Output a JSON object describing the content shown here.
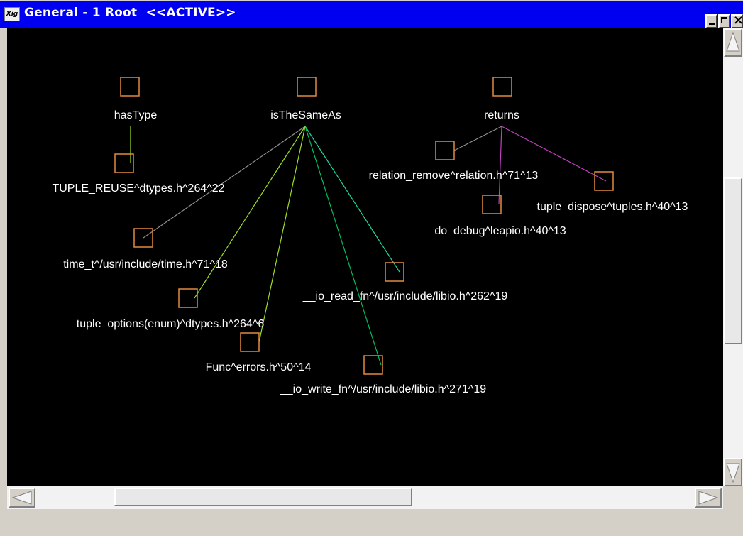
{
  "window": {
    "title": "General - 1 Root  <<ACTIVE>>",
    "icon": "app-icon",
    "close_label": "×"
  },
  "colors": {
    "title_bar": "#0000f0",
    "canvas_background": "#000000",
    "node_border": "#e08a40",
    "label": "#ffffff",
    "edge_gray": "#909090",
    "edge_yellow_green": "#a0e020",
    "edge_green": "#00c060",
    "edge_teal": "#20d8a0",
    "edge_magenta": "#c040c0"
  },
  "graph": {
    "nodes": [
      {
        "id": "hasType",
        "label": "hasType"
      },
      {
        "id": "isTheSameAs",
        "label": "isTheSameAs"
      },
      {
        "id": "returns",
        "label": "returns"
      },
      {
        "id": "tuple_reuse",
        "label": "TUPLE_REUSE^dtypes.h^264^22"
      },
      {
        "id": "relation_remove",
        "label": "relation_remove^relation.h^71^13"
      },
      {
        "id": "tuple_dispose",
        "label": "tuple_dispose^tuples.h^40^13"
      },
      {
        "id": "do_debug",
        "label": "do_debug^leapio.h^40^13"
      },
      {
        "id": "time_t",
        "label": "time_t^/usr/include/time.h^71^18"
      },
      {
        "id": "io_read_fn",
        "label": "__io_read_fn^/usr/include/libio.h^262^19"
      },
      {
        "id": "tuple_options",
        "label": "tuple_options(enum)^dtypes.h^264^6"
      },
      {
        "id": "func_errors",
        "label": "Func^errors.h^50^14"
      },
      {
        "id": "io_write_fn",
        "label": "__io_write_fn^/usr/include/libio.h^271^19"
      }
    ],
    "edges": [
      {
        "from": "hasType",
        "to": "tuple_reuse",
        "color": "edge_yellow_green"
      },
      {
        "from": "isTheSameAs",
        "to": "time_t",
        "color": "edge_gray"
      },
      {
        "from": "isTheSameAs",
        "to": "tuple_options",
        "color": "edge_yellow_green"
      },
      {
        "from": "isTheSameAs",
        "to": "func_errors",
        "color": "edge_yellow_green"
      },
      {
        "from": "isTheSameAs",
        "to": "io_write_fn",
        "color": "edge_green"
      },
      {
        "from": "isTheSameAs",
        "to": "io_read_fn",
        "color": "edge_teal"
      },
      {
        "from": "returns",
        "to": "relation_remove",
        "color": "edge_gray"
      },
      {
        "from": "returns",
        "to": "do_debug",
        "color": "edge_magenta"
      },
      {
        "from": "returns",
        "to": "tuple_dispose",
        "color": "edge_magenta"
      }
    ]
  }
}
